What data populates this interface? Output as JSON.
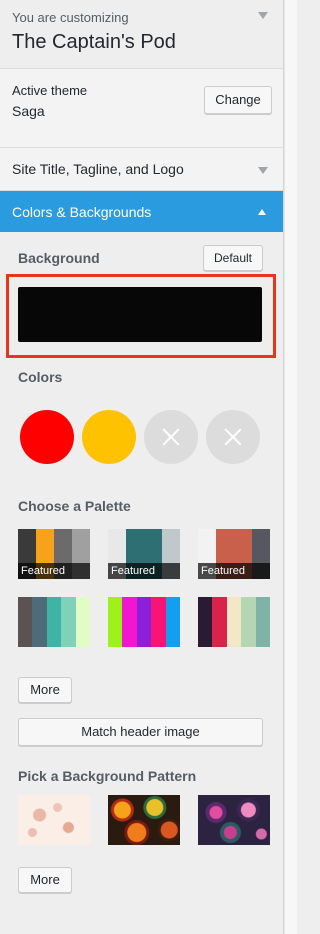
{
  "header": {
    "customizing_label": "You are customizing",
    "site_name": "The Captain's Pod"
  },
  "theme": {
    "label": "Active theme",
    "name": "Saga",
    "change_button": "Change"
  },
  "sections": {
    "site_title": "Site Title, Tagline, and Logo",
    "colors": "Colors & Backgrounds"
  },
  "background": {
    "heading": "Background",
    "default_button": "Default",
    "color": "#070707"
  },
  "colors": {
    "heading": "Colors",
    "swatches": [
      {
        "color": "#ff0000",
        "empty": false
      },
      {
        "color": "#ffc200",
        "empty": false
      },
      {
        "color": "#dcdcdc",
        "empty": true
      },
      {
        "color": "#dcdcdc",
        "empty": true
      }
    ]
  },
  "palettes": {
    "heading": "Choose a Palette",
    "featured_label": "Featured",
    "items": [
      {
        "colors": [
          "#3a3a3a",
          "#f7a21b",
          "#6b6b6b",
          "#a0a0a0"
        ],
        "featured": true
      },
      {
        "colors": [
          "#e8e8e8",
          "#2e6f73",
          "#2e6f73",
          "#bfc9c9"
        ],
        "featured": true
      },
      {
        "colors": [
          "#f2f2f2",
          "#c8604b",
          "#c8604b",
          "#55585f"
        ],
        "featured": true
      },
      {
        "colors": [
          "#5b5352",
          "#4d6b78",
          "#3fb3a4",
          "#7fd1b9",
          "#e2fcc6"
        ],
        "featured": false
      },
      {
        "colors": [
          "#9df219",
          "#f316d0",
          "#8b20d8",
          "#f71474",
          "#139ef1"
        ],
        "featured": false
      },
      {
        "colors": [
          "#2a1b34",
          "#d9234a",
          "#f2e8c6",
          "#b5d6b2",
          "#7fb3a8"
        ],
        "featured": false
      }
    ],
    "more_button": "More",
    "match_button": "Match header image"
  },
  "patterns": {
    "heading": "Pick a Background Pattern",
    "items": [
      {
        "name": "floral-swirl"
      },
      {
        "name": "stained-glass-orbs"
      },
      {
        "name": "kaleidoscope"
      }
    ],
    "more_button": "More"
  }
}
